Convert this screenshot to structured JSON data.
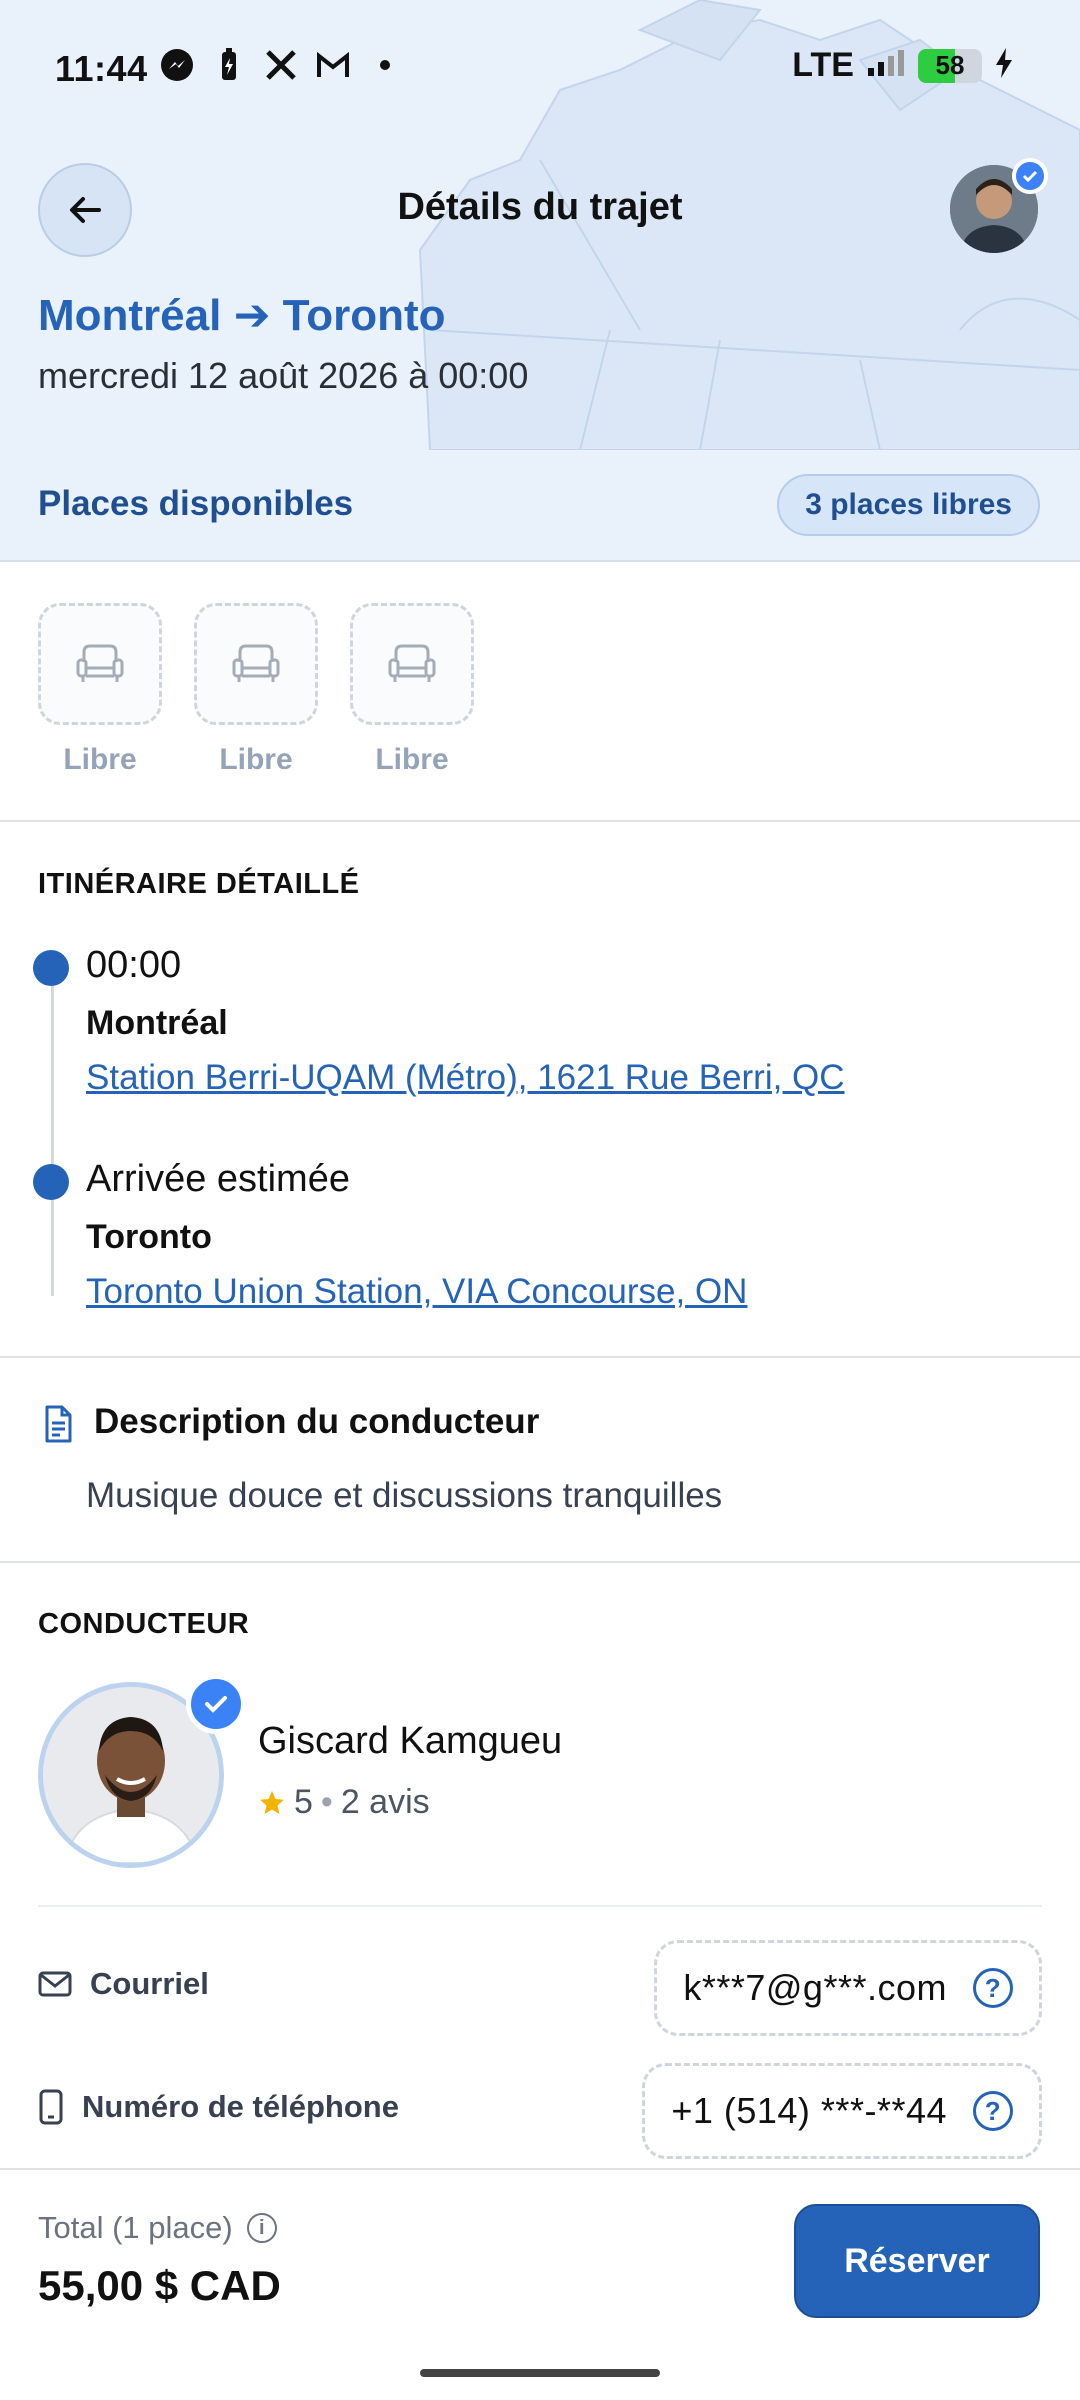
{
  "status_bar": {
    "time": "11:44",
    "network": "LTE",
    "battery_level": "58"
  },
  "header": {
    "title": "Détails du trajet",
    "route": "Montréal ➔ Toronto",
    "date": "mercredi 12 août 2026 à 00:00"
  },
  "seats": {
    "title": "Places disponibles",
    "badge": "3 places libres",
    "items": [
      {
        "label": "Libre"
      },
      {
        "label": "Libre"
      },
      {
        "label": "Libre"
      }
    ]
  },
  "itinerary": {
    "heading": "ITINÉRAIRE DÉTAILLÉ",
    "stops": [
      {
        "time": "00:00",
        "city": "Montréal",
        "address": "Station Berri-UQAM (Métro), 1621 Rue Berri, QC"
      },
      {
        "time": "Arrivée estimée",
        "city": "Toronto",
        "address": "Toronto Union Station, VIA Concourse, ON"
      }
    ]
  },
  "description": {
    "title": "Description du conducteur",
    "text": "Musique douce et discussions tranquilles"
  },
  "driver": {
    "heading": "CONDUCTEUR",
    "name": "Giscard Kamgueu",
    "rating": "5",
    "reviews": "2 avis",
    "email_label": "Courriel",
    "email_value": "k***7@g***.com",
    "phone_label": "Numéro de téléphone",
    "phone_value": "+1 (514) ***-**44"
  },
  "footer": {
    "total_label": "Total (1 place)",
    "total_price": "55,00 $ CAD",
    "reserve_label": "Réserver"
  },
  "colors": {
    "primary": "#2563b8",
    "header_bg": "#e9f1fb",
    "verified": "#3b82f6",
    "star": "#f5b301"
  }
}
